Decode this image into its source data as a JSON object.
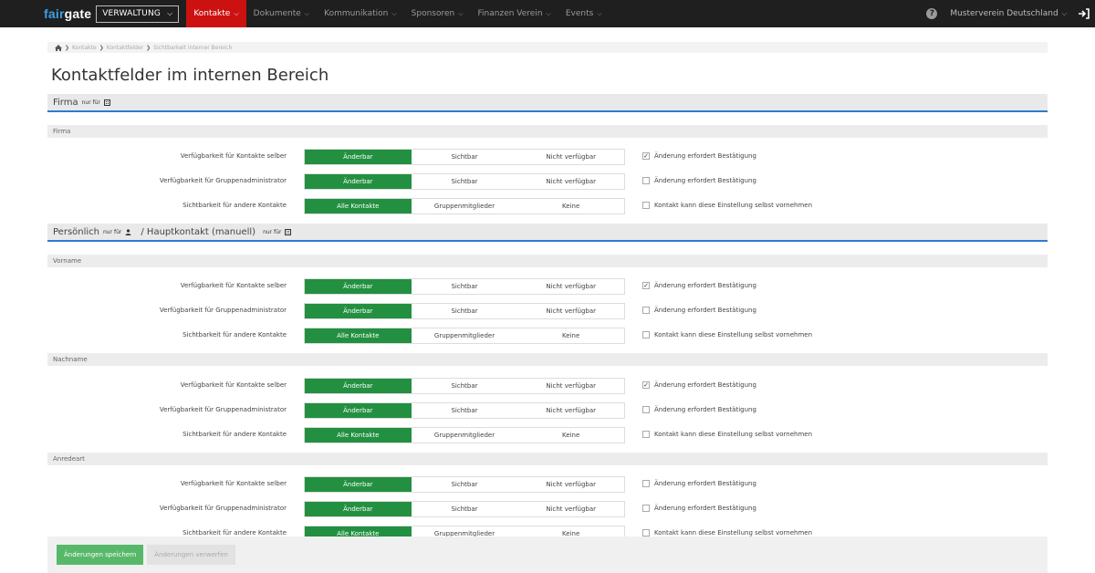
{
  "nav": {
    "logo_prefix": "fair",
    "logo_suffix": "gate",
    "admin_label": "VERWALTUNG",
    "items": [
      {
        "label": "Kontakte"
      },
      {
        "label": "Dokumente"
      },
      {
        "label": "Kommunikation"
      },
      {
        "label": "Sponsoren"
      },
      {
        "label": "Finanzen Verein"
      },
      {
        "label": "Events"
      }
    ],
    "org_name": "Musterverein Deutschland"
  },
  "breadcrumb": [
    "Kontakte",
    "Kontaktfelder",
    "Sichtbarkeit interner Bereich"
  ],
  "page_title": "Kontaktfelder im internen Bereich",
  "sections": {
    "firma": {
      "title": "Firma",
      "hint": "nur für"
    },
    "persoenlich": {
      "title": "Persönlich",
      "hint1": "nur für",
      "sep": "/ Hauptkontakt (manuell)",
      "hint2": "nur für"
    }
  },
  "labels": {
    "row1": "Verfügbarkeit für Kontakte selber",
    "row2": "Verfügbarkeit für Gruppenadministrator",
    "row3": "Sichtbarkeit für andere Kontakte",
    "opt_aenderbar": "Änderbar",
    "opt_sichtbar": "Sichtbar",
    "opt_nicht": "Nicht verfügbar",
    "opt_alle": "Alle Kontakte",
    "opt_gruppen": "Gruppenmitglieder",
    "opt_keine": "Keine",
    "chk_bestaetigung": "Änderung erfordert Bestätigung",
    "chk_selbst": "Kontakt kann diese Einstellung selbst vornehmen"
  },
  "fields": [
    {
      "name": "Firma",
      "chk1": true
    },
    {
      "name": "Vorname",
      "chk1": true
    },
    {
      "name": "Nachname",
      "chk1": true
    },
    {
      "name": "Anredeart",
      "chk1": false
    }
  ],
  "footer": {
    "save": "Änderungen speichern",
    "discard": "Änderungen verwerfen"
  },
  "colors": {
    "accent_red": "#cc1111",
    "active_green": "#229040",
    "save_green": "#58b86a",
    "rule_blue": "#2e7ad1"
  }
}
